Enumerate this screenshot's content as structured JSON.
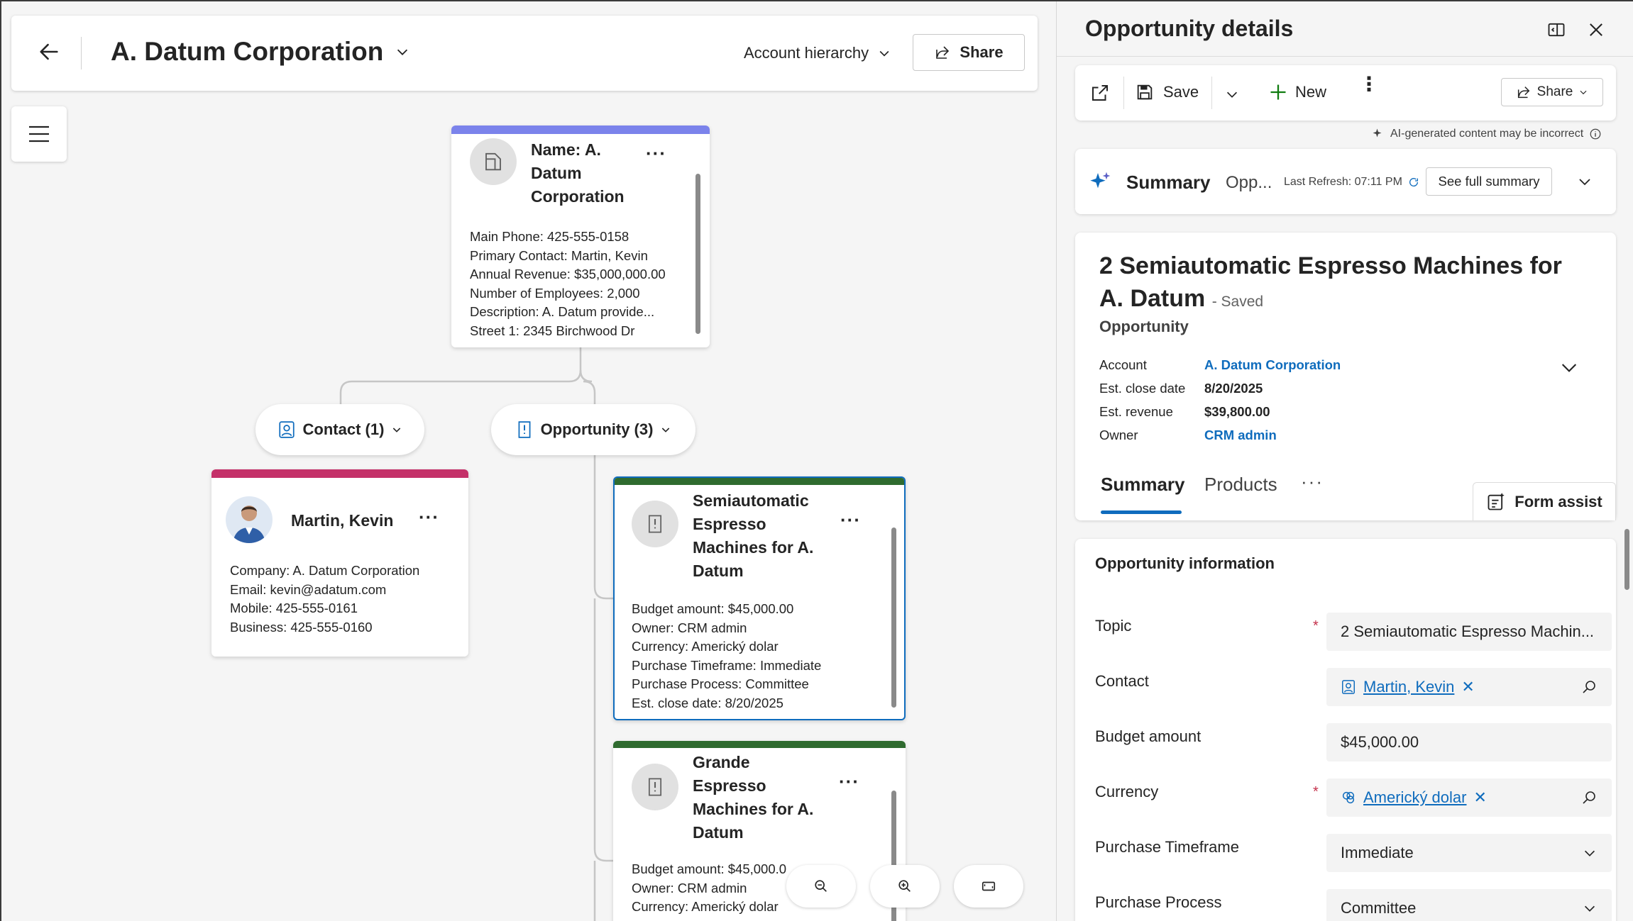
{
  "header": {
    "title": "A. Datum Corporation",
    "view_selector": "Account hierarchy",
    "share_label": "Share"
  },
  "account_card": {
    "title": "Name: A. Datum Corporation",
    "title_lines": [
      "Name: A.",
      "Datum",
      "Corporation"
    ],
    "lines": [
      "Main Phone: 425-555-0158",
      "Primary Contact: Martin, Kevin",
      "Annual Revenue: $35,000,000.00",
      "Number of Employees: 2,000",
      "Description: A. Datum provide...",
      "Street 1: 2345 Birchwood Dr"
    ]
  },
  "groups": {
    "contact_label": "Contact (1)",
    "opportunity_label": "Opportunity (3)"
  },
  "contact_card": {
    "title": "Martin, Kevin",
    "lines": [
      "Company: A. Datum Corporation",
      "Email: kevin@adatum.com",
      "Mobile: 425-555-0161",
      "Business: 425-555-0160"
    ]
  },
  "opp_card_1": {
    "title_lines": [
      "Semiautomatic",
      "Espresso",
      "Machines for A.",
      "Datum"
    ],
    "lines": [
      "Budget amount: $45,000.00",
      "Owner: CRM admin",
      "Currency: Americký dolar",
      "Purchase Timeframe: Immediate",
      "Purchase Process: Committee",
      "Est. close date: 8/20/2025"
    ]
  },
  "opp_card_2": {
    "title_lines": [
      "Grande",
      "Espresso",
      "Machines for A.",
      "Datum"
    ],
    "lines": [
      "Budget amount: $45,000.0",
      "Owner: CRM admin",
      "Currency: Americký dolar"
    ]
  },
  "panel": {
    "title": "Opportunity details",
    "toolbar": {
      "save_label": "Save",
      "new_label": "New",
      "share_label": "Share"
    },
    "ai_notice": "AI-generated content may be incorrect",
    "summary_bar": {
      "title": "Summary",
      "subtitle": "Opp...",
      "last_refresh": "Last Refresh: 07:11 PM",
      "see_full_label": "See full summary"
    },
    "record": {
      "title_line1": "2 Semiautomatic Espresso Machines for",
      "title_line2": "A. Datum",
      "saved_label": "- Saved",
      "entity": "Opportunity",
      "fields": [
        {
          "label": "Account",
          "value": "A. Datum Corporation"
        },
        {
          "label": "Est. close date",
          "value": "8/20/2025"
        },
        {
          "label": "Est. revenue",
          "value": "$39,800.00"
        },
        {
          "label": "Owner",
          "value": "CRM admin"
        }
      ],
      "tabs": [
        "Summary",
        "Products"
      ],
      "form_assist_label": "Form assist"
    },
    "form": {
      "section_title": "Opportunity information",
      "topic_label": "Topic",
      "topic_value": "2 Semiautomatic Espresso Machin...",
      "contact_label": "Contact",
      "contact_value": "Martin, Kevin",
      "budget_label": "Budget amount",
      "budget_value": "$45,000.00",
      "currency_label": "Currency",
      "currency_value": "Americký dolar",
      "timeframe_label": "Purchase Timeframe",
      "timeframe_value": "Immediate",
      "process_label": "Purchase Process",
      "process_value": "Committee"
    }
  },
  "colors": {
    "account_accent": "#7b83eb",
    "contact_accent": "#c43169",
    "opportunity_accent": "#2f6b2f",
    "selected_border": "#0f6cbd",
    "link": "#0f6cbd"
  }
}
